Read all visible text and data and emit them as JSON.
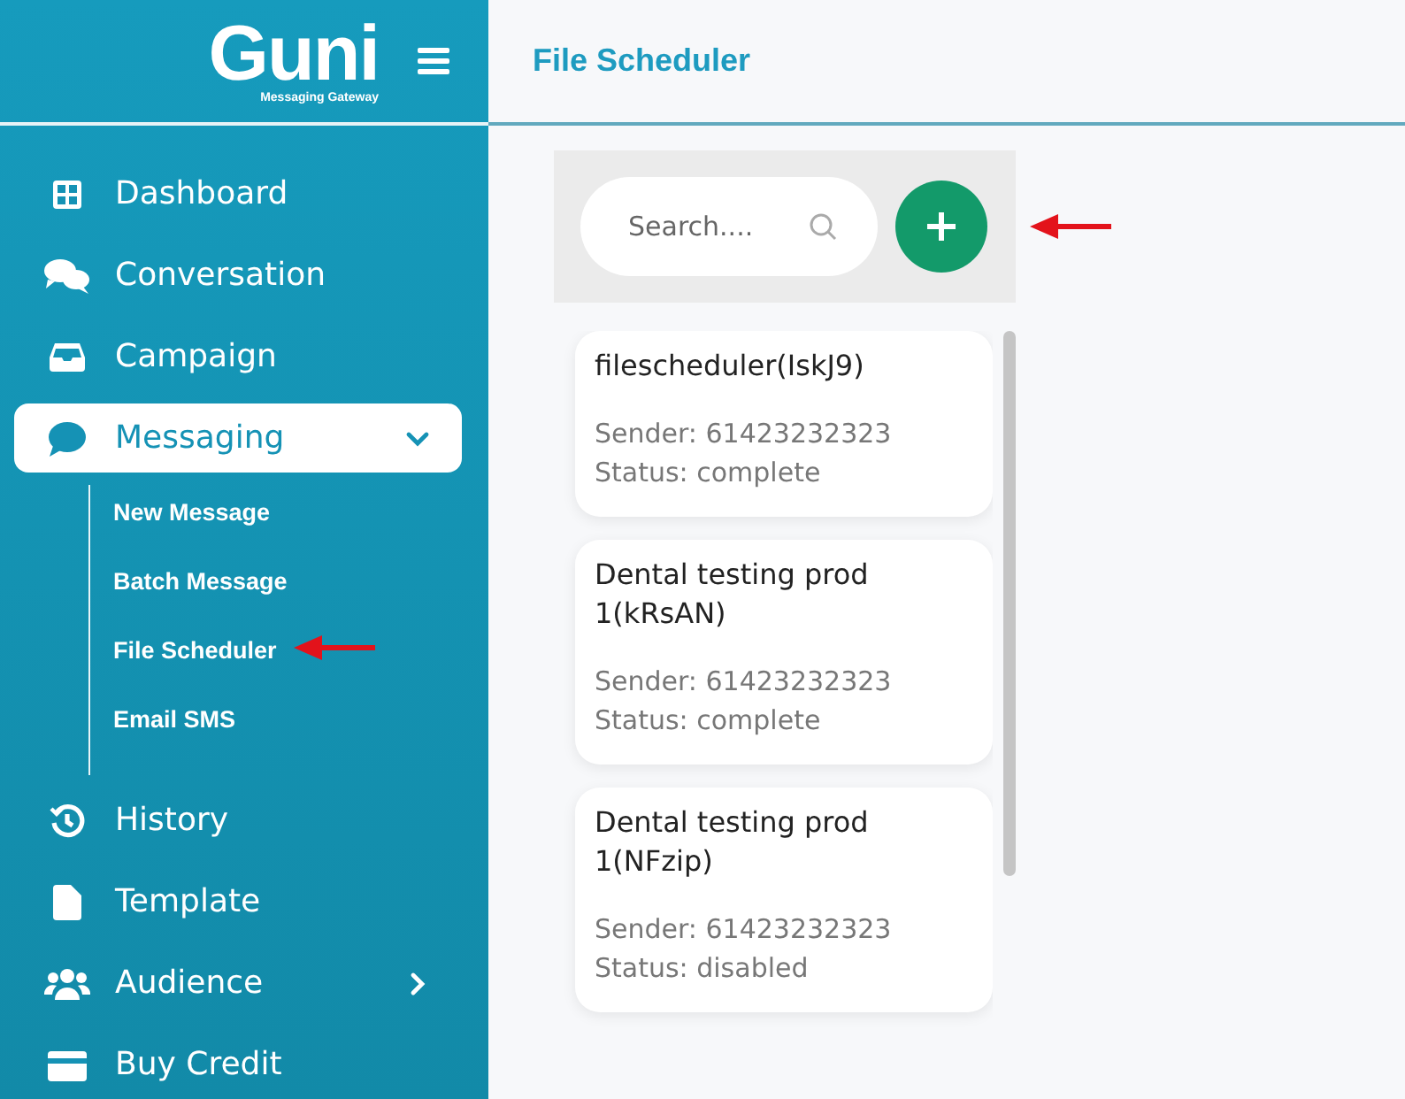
{
  "logo": {
    "name": "Guni",
    "tagline": "Messaging Gateway"
  },
  "page_title": "File Scheduler",
  "nav": [
    {
      "label": "Dashboard",
      "kind": "grid",
      "selected": false
    },
    {
      "label": "Conversation",
      "kind": "chat",
      "selected": false
    },
    {
      "label": "Campaign",
      "kind": "inbox",
      "selected": false
    },
    {
      "label": "Messaging",
      "kind": "sms",
      "selected": true,
      "expanded": true,
      "children": [
        {
          "label": "New Message"
        },
        {
          "label": "Batch Message"
        },
        {
          "label": "File Scheduler",
          "annotated": true
        },
        {
          "label": "Email SMS"
        }
      ]
    },
    {
      "label": "History",
      "kind": "history",
      "selected": false
    },
    {
      "label": "Template",
      "kind": "file",
      "selected": false
    },
    {
      "label": "Audience",
      "kind": "users",
      "selected": false,
      "expanded": false
    },
    {
      "label": "Buy Credit",
      "kind": "card",
      "selected": false
    }
  ],
  "search": {
    "placeholder": "Search...."
  },
  "schedules": [
    {
      "title": "filescheduler(IskJ9)",
      "sender": "Sender: 61423232323",
      "status": "Status: complete"
    },
    {
      "title": "Dental testing prod 1(kRsAN)",
      "sender": "Sender: 61423232323",
      "status": "Status: complete"
    },
    {
      "title": "Dental testing prod 1(NFzip)",
      "sender": "Sender: 61423232323",
      "status": "Status: disabled"
    }
  ]
}
